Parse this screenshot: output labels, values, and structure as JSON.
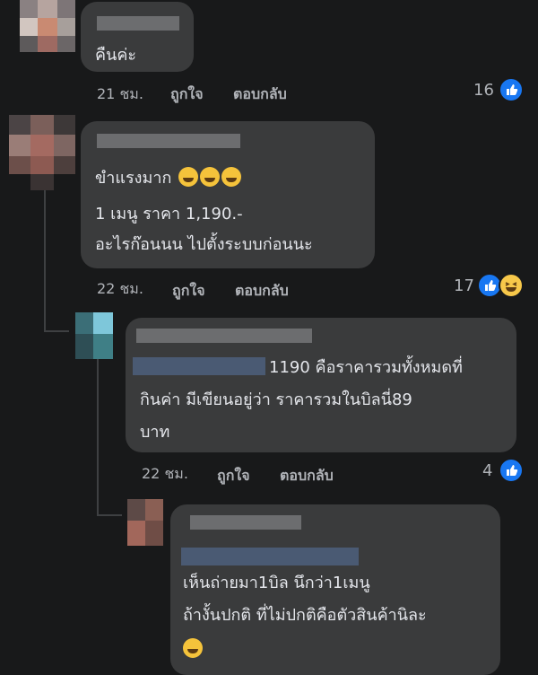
{
  "comments": [
    {
      "text_lines": [
        "คืนค่ะ"
      ],
      "meta": {
        "time": "21 ชม.",
        "like_label": "ถูกใจ",
        "reply_label": "ตอบกลับ"
      },
      "reactions": {
        "count": "16",
        "types": [
          "like-icon"
        ]
      }
    },
    {
      "text_lines": [
        "ขำแรงมาก",
        "1 เมนู ราคา 1,190.-",
        "อะไรก๊อนนน ไปตั้งระบบก่อนนะ"
      ],
      "emoji": [
        "rofl-emoji",
        "rofl-emoji",
        "rofl-emoji"
      ],
      "meta": {
        "time": "22 ชม.",
        "like_label": "ถูกใจ",
        "reply_label": "ตอบกลับ"
      },
      "reactions": {
        "count": "17",
        "types": [
          "like-icon",
          "haha-icon"
        ]
      }
    },
    {
      "text_lines": [
        "1190 คือราคารวมทั้งหมดที่",
        "กินค่า มีเขียนอยู่ว่า ราคารวมในบิลนี่89",
        "บาท"
      ],
      "meta": {
        "time": "22 ชม.",
        "like_label": "ถูกใจ",
        "reply_label": "ตอบกลับ"
      },
      "reactions": {
        "count": "4",
        "types": [
          "like-icon"
        ]
      }
    },
    {
      "text_lines": [
        "เห็นถ่ายมา1บิล นึกว่า1เมนู",
        "ถ้างั้นปกติ ที่ไม่ปกติคือตัวสินค้านิละ"
      ],
      "emoji": [
        "grin-emoji"
      ]
    }
  ],
  "colors": {
    "background": "#18191a",
    "bubble": "#3a3b3c",
    "like": "#1877f2",
    "meta": "#b0b3b8"
  }
}
